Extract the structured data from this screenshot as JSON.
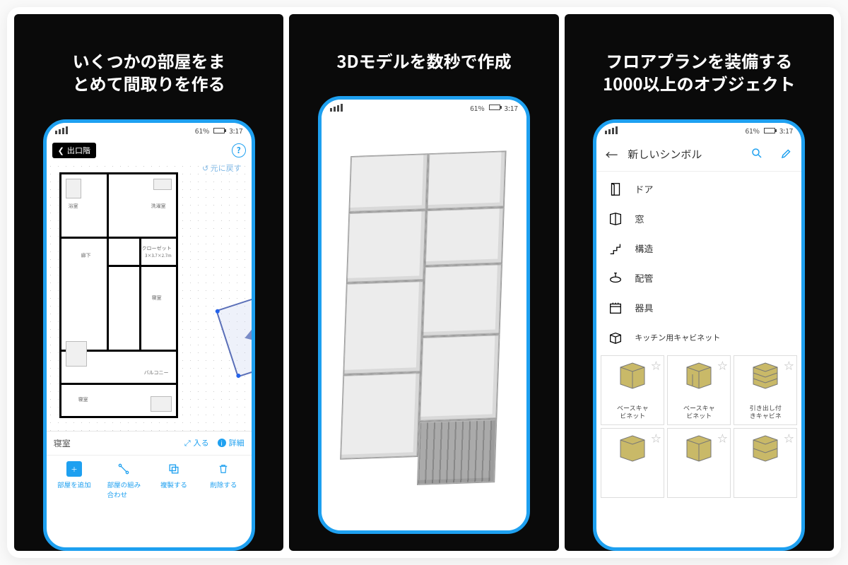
{
  "panels": {
    "p1": {
      "headline": "いくつかの部屋をま\nとめて間取りを作る"
    },
    "p2": {
      "headline": "3Dモデルを数秒で作成"
    },
    "p3": {
      "headline": "フロアプランを装備する\n1000以上のオブジェクト"
    }
  },
  "status": {
    "battery": "61%",
    "time": "3:17"
  },
  "screen1": {
    "back_chip": "出口階",
    "help": "?",
    "undo": "↺ 元に戻す",
    "rooms": {
      "bath": "浴室",
      "wash": "洗濯室",
      "closet": "クローゼット",
      "closet_sub": "3×3.7×2.7m",
      "corridor": "廊下",
      "bedroom": "寝室",
      "balcony": "バルコニー"
    },
    "meta_room": "寝室",
    "meta_enter": "入る",
    "meta_detail": "詳細",
    "actions": {
      "add": "部屋を追加",
      "combine": "部屋の組み\n合わせ",
      "duplicate": "複製する",
      "delete": "削除する"
    }
  },
  "screen3": {
    "title": "新しいシンボル",
    "categories": [
      {
        "id": "door",
        "label": "ドア"
      },
      {
        "id": "window",
        "label": "窓"
      },
      {
        "id": "structure",
        "label": "構造"
      },
      {
        "id": "plumbing",
        "label": "配管"
      },
      {
        "id": "appliance",
        "label": "器具"
      },
      {
        "id": "kitchen-cabinet",
        "label": "キッチン用キャビネット"
      }
    ],
    "tiles": [
      {
        "label": "ベースキャ\nビネット"
      },
      {
        "label": "ベースキャ\nビネット"
      },
      {
        "label": "引き出し付\nきキャビネ"
      },
      {
        "label": ""
      },
      {
        "label": ""
      },
      {
        "label": ""
      }
    ]
  },
  "colors": {
    "accent": "#1ea0f0"
  }
}
